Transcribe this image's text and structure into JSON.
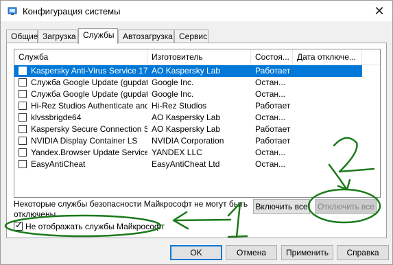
{
  "window": {
    "title": "Конфигурация системы"
  },
  "tabs": [
    {
      "label": "Общие",
      "active": false
    },
    {
      "label": "Загрузка",
      "active": false
    },
    {
      "label": "Службы",
      "active": true
    },
    {
      "label": "Автозагрузка",
      "active": false
    },
    {
      "label": "Сервис",
      "active": false
    }
  ],
  "services_table": {
    "columns": [
      "Служба",
      "Изготовитель",
      "Состоя...",
      "Дата отключе..."
    ],
    "rows": [
      {
        "service": "Kaspersky Anti-Virus Service 17....",
        "manufacturer": "AO Kaspersky Lab",
        "status": "Работает",
        "date": "",
        "checked": false,
        "selected": true
      },
      {
        "service": "Служба Google Update (gupdate)",
        "manufacturer": "Google Inc.",
        "status": "Остан...",
        "date": "",
        "checked": false,
        "selected": false
      },
      {
        "service": "Служба Google Update (gupdat...",
        "manufacturer": "Google Inc.",
        "status": "Остан...",
        "date": "",
        "checked": false,
        "selected": false
      },
      {
        "service": "Hi-Rez Studios Authenticate and...",
        "manufacturer": "Hi-Rez Studios",
        "status": "Работает",
        "date": "",
        "checked": false,
        "selected": false
      },
      {
        "service": "klvssbrigde64",
        "manufacturer": "AO Kaspersky Lab",
        "status": "Остан...",
        "date": "",
        "checked": false,
        "selected": false
      },
      {
        "service": "Kaspersky Secure Connection S...",
        "manufacturer": "AO Kaspersky Lab",
        "status": "Работает",
        "date": "",
        "checked": false,
        "selected": false
      },
      {
        "service": "NVIDIA Display Container LS",
        "manufacturer": "NVIDIA Corporation",
        "status": "Работает",
        "date": "",
        "checked": false,
        "selected": false
      },
      {
        "service": "Yandex.Browser Update Service",
        "manufacturer": "YANDEX LLC",
        "status": "Остан...",
        "date": "",
        "checked": false,
        "selected": false
      },
      {
        "service": "EasyAntiCheat",
        "manufacturer": "EasyAntiCheat Ltd",
        "status": "Остан...",
        "date": "",
        "checked": false,
        "selected": false
      }
    ]
  },
  "note": "Некоторые службы безопасности Майкрософт не могут быть отключены.",
  "buttons": {
    "enable_all": "Включить все",
    "disable_all": "Отключить все",
    "ok": "OK",
    "cancel": "Отмена",
    "apply": "Применить",
    "help": "Справка"
  },
  "hide_ms": {
    "label": "Не отображать службы Майкрософт",
    "checked": true
  },
  "annotations": {
    "label_1": "1",
    "label_2": "2",
    "color": "#1a7a1a"
  },
  "colors": {
    "selection": "#0078d7",
    "window_bg": "#f0f0f0"
  }
}
